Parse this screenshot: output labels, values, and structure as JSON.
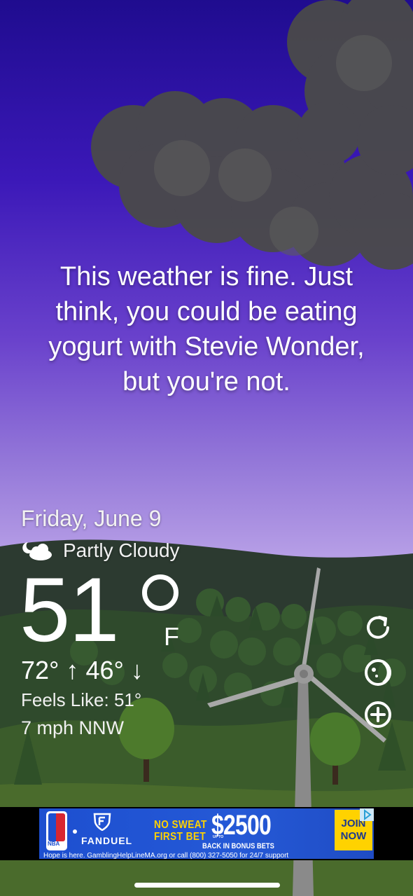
{
  "quote": {
    "line1": "This weather is fine. Just",
    "line2": "think, you could be eating",
    "line3": "yogurt with Stevie Wonder,",
    "line4": "but you're not."
  },
  "weather": {
    "date": "Friday, June 9",
    "condition": "Partly Cloudy",
    "condition_icon": "partly-cloudy-night-icon",
    "temperature": "51",
    "unit": "F",
    "high_low": "72° ↑ 46° ↓",
    "feels_like": "Feels Like: 51°",
    "wind": "7 mph NNW"
  },
  "side_buttons": [
    {
      "name": "refresh-button",
      "icon": "refresh-icon"
    },
    {
      "name": "moon-phase-button",
      "icon": "moon-icon"
    },
    {
      "name": "add-location-button",
      "icon": "plus-circle-icon"
    }
  ],
  "ad": {
    "league": "NBA",
    "brand": "FANDUEL",
    "no_sweat": "NO SWEAT",
    "first_bet": "FIRST BET",
    "up_to": "UP TO",
    "amount": "$2500",
    "bonus": "BACK IN BONUS BETS",
    "cta_line1": "JOIN",
    "cta_line2": "NOW",
    "disclaimer": "Hope is here. GamblingHelpLineMA.org or call (800) 327-5050 for 24/7 support"
  },
  "colors": {
    "sky_top": "#1f0c8f",
    "sky_bottom": "#c2ace8",
    "ad_blue": "#1d4fd0",
    "ad_yellow": "#ffd200"
  }
}
